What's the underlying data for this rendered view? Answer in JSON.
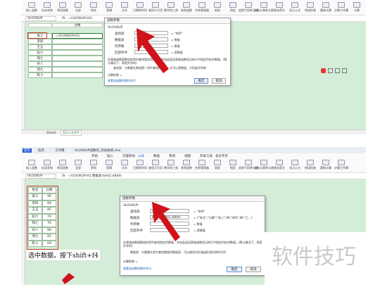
{
  "top": {
    "toolbar_items": [
      "插入函数",
      "自动求和",
      "常用函数",
      "全部",
      "财务",
      "逻辑",
      "文本",
      "日期和时间",
      "查找与引用",
      "数学和三角",
      "其他函数",
      "名称管理器",
      "粘贴",
      "指定",
      "追踪引用单元格",
      "追踪从属单元格",
      "移去箭头",
      "显示公式",
      "错误检查",
      "重新计算",
      "计算工作簿",
      "计算"
    ],
    "name_box": "VLOOKUP",
    "formula": "=VLOOKUP(A2)",
    "col_header": "分数",
    "cell_names": [
      "张三",
      "李四",
      "王五",
      "赵六",
      "钱七",
      "孙八",
      "周九",
      "陈十"
    ],
    "active_cell_text": "=VLOOKUP(A2)",
    "dialog": {
      "title": "函数参数",
      "func": "VLOOKUP",
      "fields": [
        {
          "label": "查找值",
          "value": "A2",
          "result": "= \"李四\""
        },
        {
          "label": "数据表",
          "value": "",
          "result": "= 数据"
        },
        {
          "label": "列序数",
          "value": "",
          "result": "= 数值"
        },
        {
          "label": "匹配条件",
          "value": "",
          "result": "= 逻辑值"
        }
      ],
      "desc": "在表格或数值数组的首列查找指定的数值，并由此返回表格或数组当前行中指定列处的数值。(默认情况下，表是升序的)",
      "desc2": "查找值：为需要在数组第一列中查找的数值，它可以是数值、引用或字符串",
      "result_label": "计算结果 =",
      "help": "查看该函数的操作技巧",
      "ok": "确定",
      "cancel": "取消"
    },
    "sheet_tab": "Sheet1",
    "sheet_tab2": "显示公式文件"
  },
  "bottom": {
    "app_tabs": [
      "首页",
      "稻壳",
      "工作簿",
      "VLOOKUP函数的_添加表格.xlsx"
    ],
    "toolbar_items": [
      "插入函数",
      "自动求和",
      "常用函数",
      "全部",
      "财务",
      "逻辑",
      "文本",
      "日期和时间",
      "查找与引用",
      "数学和三角",
      "其他函数",
      "名称管理器",
      "粘贴",
      "指定",
      "追踪引用单元格",
      "追踪从属单元格",
      "移去箭头",
      "显示公式",
      "错误检查",
      "重新计算",
      "计算工作簿"
    ],
    "menu": [
      "开始",
      "插入",
      "页面布局",
      "公式",
      "数据",
      "审阅",
      "视图",
      "开发工具",
      "会员专享"
    ],
    "name_box": "VLOOKUP",
    "formula": "=VLOOKUP(A2,数据表!$A$1:$B$9)",
    "headers": [
      "姓名",
      "分数"
    ],
    "rows": [
      [
        "张三",
        "96"
      ],
      [
        "李四",
        "89"
      ],
      [
        "王五",
        "85"
      ],
      [
        "赵六",
        "79"
      ],
      [
        "钱七",
        "76"
      ],
      [
        "孙八",
        "86"
      ],
      [
        "周九",
        "85"
      ],
      [
        "陈十",
        "69"
      ]
    ],
    "dialog": {
      "title": "函数参数",
      "func": "VLOOKUP",
      "fields": [
        {
          "label": "查找值",
          "value": "A2",
          "result": "= \"李四\""
        },
        {
          "label": "数据表",
          "value": "数据表!$A$1:$B$9",
          "result": "= {\"姓名\",\"分数\";\"张三\",96;\"李四\",89;\"王...}"
        },
        {
          "label": "列序数",
          "value": "",
          "result": "= 数值"
        },
        {
          "label": "匹配条件",
          "value": "",
          "result": "= 逻辑值"
        }
      ],
      "desc": "在表格或数值数组的首列查找指定的数值，并由此返回表格或数组当前行中指定列处的数值。(默认情况下，表是升序的)",
      "desc2": "数据表：为需要在其中查找数据的数据表，可以使用对区域或区域名称的引用",
      "result_label": "计算结果 =",
      "help": "查看该函数的操作技巧",
      "ok": "确定",
      "cancel": "取消"
    },
    "caption": "选中数据，按下shift+f4"
  },
  "watermark": "软件技巧",
  "colors": {
    "sheet_bg": "#d4edd8",
    "arrow": "#d0121b",
    "highlight": "#c0392b"
  }
}
